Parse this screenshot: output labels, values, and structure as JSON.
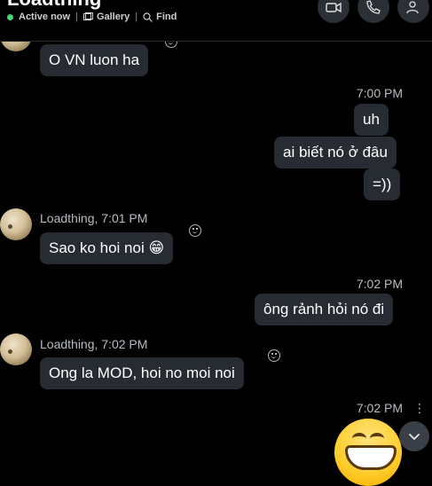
{
  "header": {
    "title": "Loadthing",
    "status": "Active now",
    "gallery_label": "Gallery",
    "find_label": "Find",
    "separator": "|"
  },
  "messages": {
    "m1": {
      "text": "O VN luon ha"
    },
    "t1": {
      "time": "7:00 PM"
    },
    "m2": {
      "text": "uh"
    },
    "m3": {
      "text": "ai biết nó ở đâu"
    },
    "m4": {
      "text": "=))"
    },
    "s1": {
      "sender": "Loadthing, 7:01 PM"
    },
    "m5": {
      "text": "Sao ko hoi noi",
      "emoji": "😁"
    },
    "t2": {
      "time": "7:02 PM"
    },
    "m6": {
      "text": "ông rảnh hỏi nó đi"
    },
    "s2": {
      "sender": "Loadthing, 7:02 PM"
    },
    "m7": {
      "text": "Ong la MOD, hoi no moi noi"
    },
    "t3": {
      "time": "7:02 PM"
    },
    "more": "⋮"
  },
  "icons": {
    "video": "video-call-icon",
    "call": "phone-icon",
    "add_person": "add-person-icon",
    "gallery": "gallery-icon",
    "find": "search-icon",
    "scroll": "chevron-down-icon"
  },
  "colors": {
    "background": "#000000",
    "bubble": "#272b32",
    "active": "#4bd37b",
    "meta_text": "#b8bcc3"
  }
}
